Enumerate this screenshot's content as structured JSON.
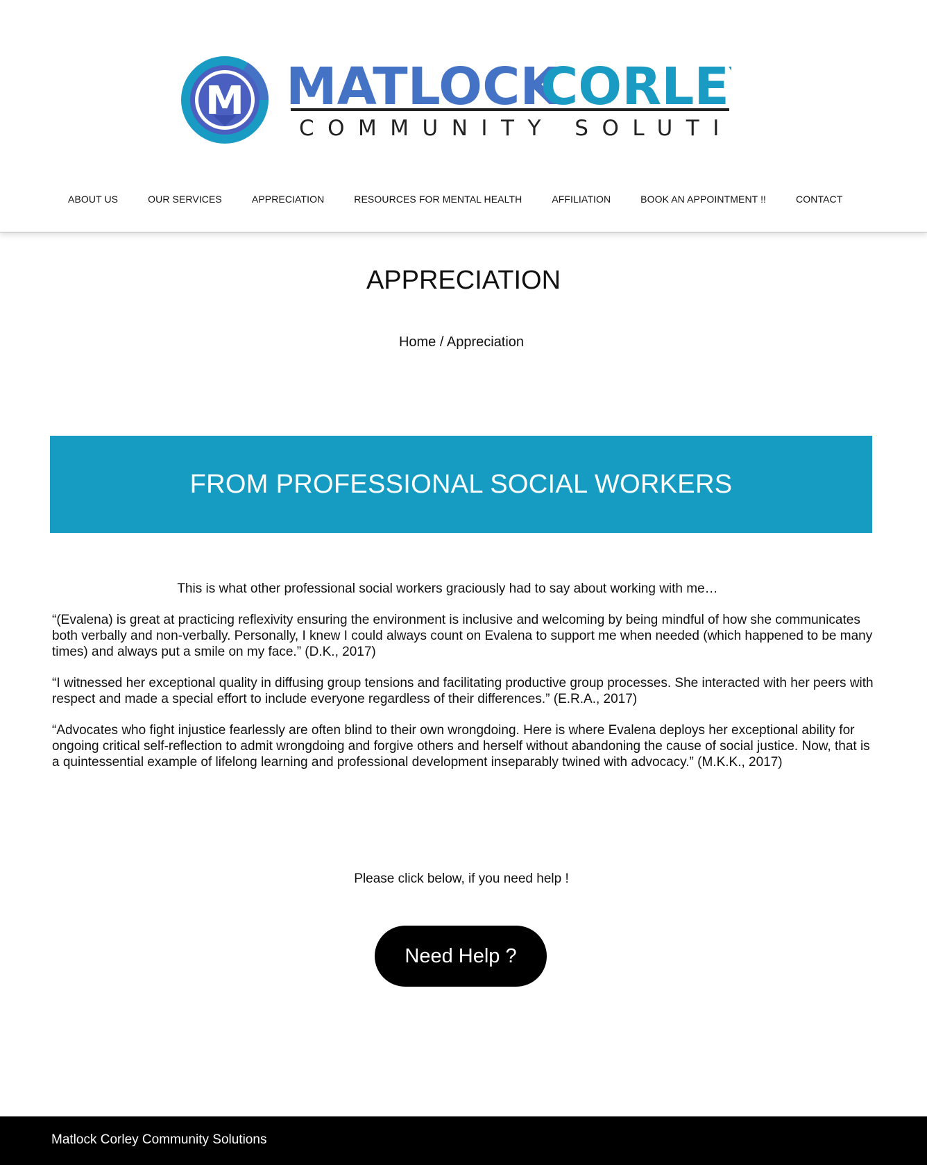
{
  "brand": {
    "name_part1": "MATLOCK",
    "name_part2": "CORLEY",
    "tagline": "COMMUNITY SOLUTIONS",
    "logo_letter": "M",
    "colors": {
      "blue": "#4473c5",
      "teal": "#1a9bc4",
      "dark": "#222222"
    }
  },
  "nav": {
    "items": [
      {
        "label": "ABOUT US"
      },
      {
        "label": "OUR SERVICES"
      },
      {
        "label": "APPRECIATION"
      },
      {
        "label": "RESOURCES FOR MENTAL HEALTH"
      },
      {
        "label": "AFFILIATION"
      },
      {
        "label": "BOOK AN APPOINTMENT !!"
      },
      {
        "label": "CONTACT"
      }
    ]
  },
  "page": {
    "title": "APPRECIATION",
    "breadcrumb": {
      "home": "Home",
      "separator": " / ",
      "current": "Appreciation"
    }
  },
  "banner": {
    "heading": "FROM PROFESSIONAL SOCIAL WORKERS",
    "color": "#169cc2"
  },
  "content": {
    "intro": "This is what other professional social workers graciously had to say about working with me…",
    "testimonials": [
      "“(Evalena) is great at practicing reflexivity ensuring the environment is inclusive and welcoming by being mindful of how she communicates both verbally and non-verbally. Personally, I knew I could always count on Evalena to support me when needed (which happened to be many times) and always put a smile on my face.”  (D.K., 2017)",
      "“I witnessed her exceptional quality in diffusing group tensions and facilitating productive group processes. She interacted with her peers with respect and made a special effort to include everyone regardless of their differences.”  (E.R.A., 2017)",
      "“Advocates who fight injustice fearlessly are often blind to their own wrongdoing. Here is where Evalena deploys her exceptional ability for ongoing critical self-reflection to admit wrongdoing and forgive others and herself without abandoning the cause of social justice. Now, that is a quintessential example of lifelong learning and professional development inseparably twined with advocacy.” (M.K.K., 2017)"
    ]
  },
  "help": {
    "prompt": "Please click below, if you need help !",
    "button_label": "Need Help ?"
  },
  "footer": {
    "text": "Matlock Corley Community Solutions"
  }
}
